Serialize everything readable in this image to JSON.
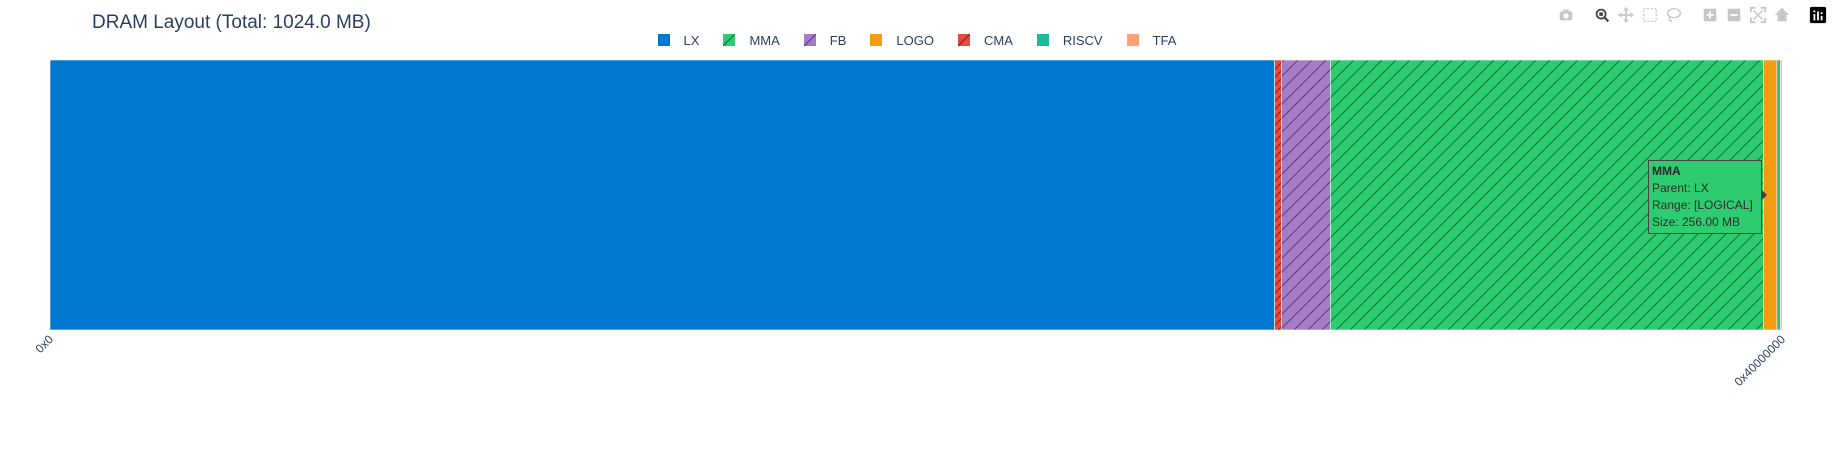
{
  "chart_data": {
    "type": "bar",
    "orientation": "horizontal-stacked",
    "title": "DRAM Layout (Total: 1024.0 MB)",
    "xlabel": "",
    "ylabel": "",
    "x_range": [
      0,
      1024
    ],
    "x_unit": "MB",
    "x_ticks": [
      {
        "value": 0,
        "label": "0x0"
      },
      {
        "value": 1024,
        "label": "0x40000000"
      }
    ],
    "grid": false,
    "legend_placement": "top-center",
    "legend": [
      {
        "name": "LX",
        "color": "#0078cf",
        "pattern": "solid"
      },
      {
        "name": "MMA",
        "color": "#2ecc71",
        "pattern": "hatch"
      },
      {
        "name": "FB",
        "color": "#a67cc9",
        "pattern": "hatch"
      },
      {
        "name": "LOGO",
        "color": "#f39c12",
        "pattern": "solid"
      },
      {
        "name": "CMA",
        "color": "#e74c3c",
        "pattern": "hatch"
      },
      {
        "name": "RISCV",
        "color": "#1abc9c",
        "pattern": "solid"
      },
      {
        "name": "TFA",
        "color": "#ffa07a",
        "pattern": "solid"
      }
    ],
    "segments": [
      {
        "name": "LX",
        "start": 0,
        "size": 724,
        "color": "#0078cf",
        "pattern": "solid"
      },
      {
        "name": "CMA",
        "start": 724,
        "size": 4,
        "color": "#e74c3c",
        "pattern": "hatch"
      },
      {
        "name": "FB",
        "start": 728,
        "size": 29,
        "color": "#a67cc9",
        "pattern": "hatch"
      },
      {
        "name": "MMA",
        "start": 757,
        "size": 256,
        "color": "#2ecc71",
        "pattern": "hatch"
      },
      {
        "name": "LOGO",
        "start": 1013,
        "size": 8,
        "color": "#f39c12",
        "pattern": "solid"
      },
      {
        "name": "RISCV",
        "start": 1021,
        "size": 2,
        "color": "#1abc9c",
        "pattern": "solid"
      },
      {
        "name": "TFA",
        "start": 1023,
        "size": 1,
        "color": "#ffa07a",
        "pattern": "solid"
      }
    ],
    "hover_label": {
      "title": "MMA",
      "lines": [
        "Parent: LX",
        "Range: [LOGICAL]",
        "Size: 256.00 MB"
      ]
    }
  },
  "modebar": {
    "buttons": [
      {
        "name": "camera-icon",
        "label": "Download plot as a png"
      },
      {
        "name": "zoom-icon",
        "label": "Zoom"
      },
      {
        "name": "pan-icon",
        "label": "Pan"
      },
      {
        "name": "box-select-icon",
        "label": "Box Select"
      },
      {
        "name": "lasso-select-icon",
        "label": "Lasso Select"
      },
      {
        "name": "zoom-in-icon",
        "label": "Zoom in"
      },
      {
        "name": "zoom-out-icon",
        "label": "Zoom out"
      },
      {
        "name": "autoscale-icon",
        "label": "Autoscale"
      },
      {
        "name": "home-icon",
        "label": "Reset axes"
      },
      {
        "name": "plotly-logo-icon",
        "label": "Produced with Plotly"
      }
    ]
  }
}
